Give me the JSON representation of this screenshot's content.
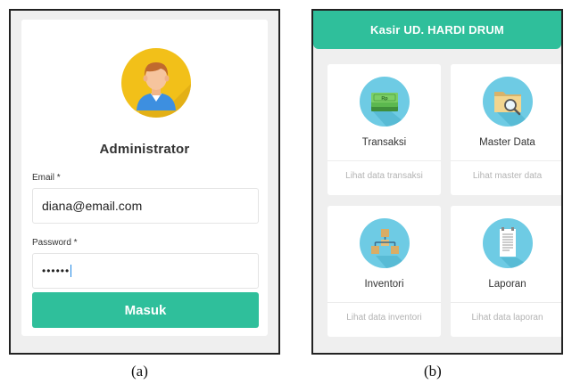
{
  "login": {
    "role_title": "Administrator",
    "email_label": "Email *",
    "email_value": "diana@email.com",
    "password_label": "Password *",
    "password_value": "••••••",
    "submit_label": "Masuk",
    "avatar_icon": "user-avatar-icon"
  },
  "dashboard": {
    "app_title": "Kasir UD. HARDI DRUM",
    "menu": [
      {
        "title": "Transaksi",
        "subtitle": "Lihat data transaksi",
        "icon": "money-icon"
      },
      {
        "title": "Master Data",
        "subtitle": "Lihat master data",
        "icon": "folder-search-icon"
      },
      {
        "title": "Inventori",
        "subtitle": "Lihat data inventori",
        "icon": "inventory-boxes-icon"
      },
      {
        "title": "Laporan",
        "subtitle": "Lihat data laporan",
        "icon": "report-document-icon"
      }
    ],
    "money_label": "Rp"
  },
  "captions": {
    "a": "(a)",
    "b": "(b)"
  },
  "colors": {
    "accent": "#2fbf9b",
    "avatar_bg": "#f2c019",
    "icon_circle": "#6ecbe4",
    "panel_bg": "#efefef"
  }
}
